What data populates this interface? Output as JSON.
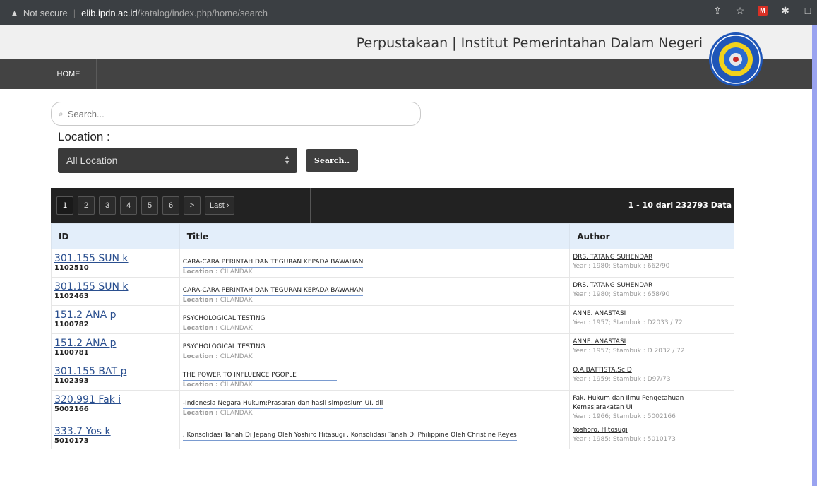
{
  "browser": {
    "warning": "Not secure",
    "host": "elib.ipdn.ac.id",
    "path": "/katalog/index.php/home/search"
  },
  "header": {
    "site_title": "Perpustakaan | Institut Pemerintahan Dalam Negeri"
  },
  "nav": {
    "home": "HOME"
  },
  "search": {
    "placeholder": "Search...",
    "location_label": "Location :",
    "location_selected": "All Location",
    "button": "Search.."
  },
  "pager": {
    "pages": [
      "1",
      "2",
      "3",
      "4",
      "5",
      "6",
      ">",
      "Last ›"
    ],
    "active": "1",
    "count_text": "1 - 10 dari 232793 Data"
  },
  "table": {
    "headers": {
      "id": "ID",
      "title": "Title",
      "author": "Author"
    },
    "rows": [
      {
        "call": "301.155 SUN k",
        "num": "1102510",
        "title": "CARA-CARA PERINTAH DAN TEGURAN KEPADA BAWAHAN",
        "loc_label": "Location :",
        "loc": "CILANDAK",
        "author": "DRS. TATANG SUHENDAR",
        "meta": "Year : 1980; Stambuk : 662/90"
      },
      {
        "call": "301.155 SUN k",
        "num": "1102463",
        "title": "CARA-CARA PERINTAH DAN TEGURAN KEPADA BAWAHAN",
        "loc_label": "Location :",
        "loc": "CILANDAK",
        "author": "DRS. TATANG SUHENDAR",
        "meta": "Year : 1980; Stambuk : 658/90"
      },
      {
        "call": "151.2 ANA p",
        "num": "1100782",
        "title": "PSYCHOLOGICAL TESTING",
        "loc_label": "Location :",
        "loc": "CILANDAK",
        "author": "ANNE. ANASTASI",
        "meta": "Year : 1957; Stambuk : D2033 / 72"
      },
      {
        "call": "151.2 ANA p",
        "num": "1100781",
        "title": "PSYCHOLOGICAL TESTING",
        "loc_label": "Location :",
        "loc": "CILANDAK",
        "author": "ANNE. ANASTASI",
        "meta": "Year : 1957; Stambuk : D 2032 / 72"
      },
      {
        "call": "301.155 BAT p",
        "num": "1102393",
        "title": "THE POWER TO INFLUENCE PGOPLE",
        "loc_label": "Location :",
        "loc": "CILANDAK",
        "author": "O.A.BATTISTA,Sc.D",
        "meta": "Year : 1959; Stambuk : D97/73"
      },
      {
        "call": "320.991 Fak i",
        "num": "5002166",
        "title": "-Indonesia Negara Hukum;Prasaran dan hasil simposium UI, dll",
        "loc_label": "Location :",
        "loc": "CILANDAK",
        "author": "Fak. Hukum dan Ilmu Pengetahuan Kemasjarakatan UI",
        "meta": "Year : 1966; Stambuk : 5002166"
      },
      {
        "call": "333.7 Yos k",
        "num": "5010173",
        "title": ". Konsolidasi Tanah Di Jepang Oleh Yoshiro Hitasugi , Konsolidasi Tanah Di Philippine Oleh Christine Reyes",
        "loc_label": "",
        "loc": "",
        "author": "Yoshoro, Hitosugi",
        "meta": "Year : 1985; Stambuk : 5010173"
      }
    ]
  }
}
